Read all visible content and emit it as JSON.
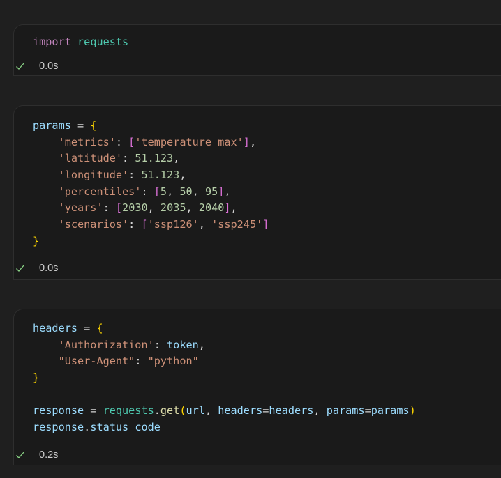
{
  "colors": {
    "background": "#1f1f1f",
    "cell_background": "#1a1a1a",
    "cell_border": "#2e2e2e",
    "success_check": "#89d185",
    "keyword": "#c586c0",
    "module": "#4ec9b0",
    "variable": "#9cdcfe",
    "string": "#ce9178",
    "number": "#b5cea8",
    "function": "#dcdcaa",
    "bracket_level1": "#ffd700",
    "bracket_level2": "#da70d6",
    "bracket_level3": "#179fff"
  },
  "cells": [
    {
      "status_icon": "check-icon",
      "exec_time": "0.0s",
      "code": {
        "l1": {
          "kw": "import",
          "mod": "requests"
        }
      }
    },
    {
      "status_icon": "check-icon",
      "exec_time": "0.0s",
      "code": {
        "l1": {
          "var": "params",
          "op": " = ",
          "open": "{"
        },
        "l2": {
          "key": "'metrics'",
          "colon": ": ",
          "open": "[",
          "val": "'temperature_max'",
          "close": "]",
          "comma": ","
        },
        "l3": {
          "key": "'latitude'",
          "colon": ": ",
          "val": "51.123",
          "comma": ","
        },
        "l4": {
          "key": "'longitude'",
          "colon": ": ",
          "val": "51.123",
          "comma": ","
        },
        "l5": {
          "key": "'percentiles'",
          "colon": ": ",
          "open": "[",
          "v1": "5",
          "sep1": ", ",
          "v2": "50",
          "sep2": ", ",
          "v3": "95",
          "close": "]",
          "comma": ","
        },
        "l6": {
          "key": "'years'",
          "colon": ": ",
          "open": "[",
          "v1": "2030",
          "sep1": ", ",
          "v2": "2035",
          "sep2": ", ",
          "v3": "2040",
          "close": "]",
          "comma": ","
        },
        "l7": {
          "key": "'scenarios'",
          "colon": ": ",
          "open": "[",
          "v1": "'ssp126'",
          "sep1": ", ",
          "v2": "'ssp245'",
          "close": "]"
        },
        "l8": {
          "close": "}"
        }
      }
    },
    {
      "status_icon": "check-icon",
      "exec_time": "0.2s",
      "code": {
        "l1": {
          "var": "headers",
          "op": " = ",
          "open": "{"
        },
        "l2": {
          "key": "'Authorization'",
          "colon": ": ",
          "val": "token",
          "comma": ","
        },
        "l3": {
          "key": "\"User-Agent\"",
          "colon": ": ",
          "val": "\"python\""
        },
        "l4": {
          "close": "}"
        },
        "l6": {
          "var": "response",
          "op": " = ",
          "mod": "requests",
          "dot": ".",
          "fn": "get",
          "open": "(",
          "a1": "url",
          "sep1": ", ",
          "k1": "headers",
          "eq1": "=",
          "a2": "headers",
          "sep2": ", ",
          "k2": "params",
          "eq2": "=",
          "a3": "params",
          "close": ")"
        },
        "l7": {
          "var": "response",
          "dot": ".",
          "attr": "status_code"
        }
      }
    }
  ]
}
